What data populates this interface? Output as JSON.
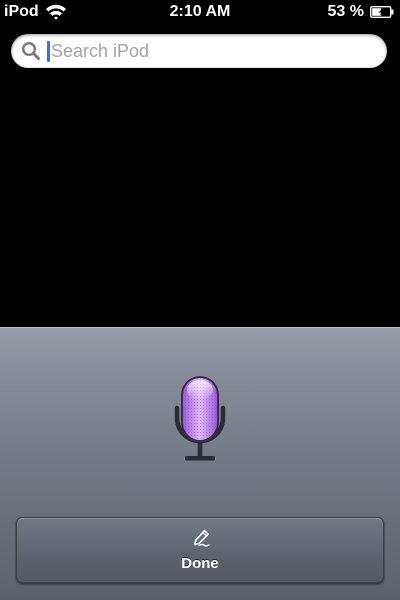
{
  "status_bar": {
    "carrier": "iPod",
    "time": "2:10 AM",
    "battery_percent": "53 %",
    "battery_level": 0.53
  },
  "search": {
    "placeholder": "Search iPod",
    "value": ""
  },
  "voice_panel": {
    "done_label": "Done"
  },
  "icons": {
    "wifi": "wifi-icon",
    "battery": "battery-charging-icon",
    "search": "magnifying-glass-icon",
    "microphone": "microphone-icon",
    "dictation_pen": "pen-icon"
  },
  "colors": {
    "caret": "#3b6fe0",
    "mic_glow": "#c77bf0",
    "panel_top": "#9aa0aa",
    "panel_bottom": "#5c616b"
  }
}
